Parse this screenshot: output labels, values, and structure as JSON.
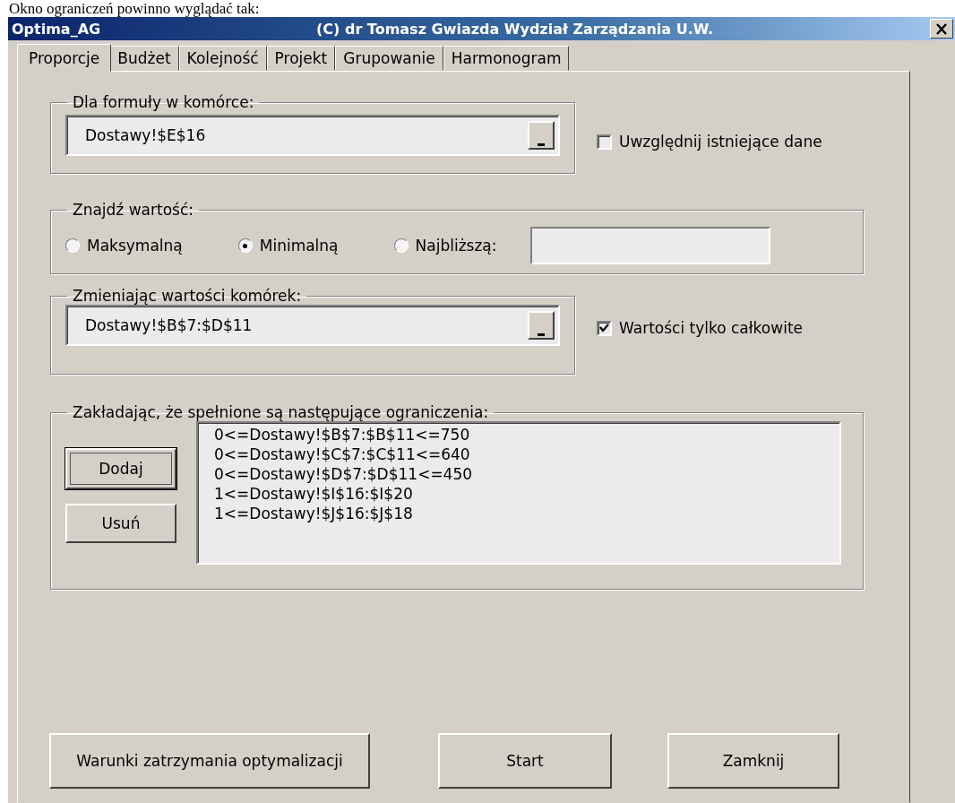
{
  "document_text": "Okno ograniczeń powinno wyglądać tak:",
  "window": {
    "title": "Optima_AG",
    "credit": "(C) dr Tomasz Gwiazda Wydział Zarządzania U.W."
  },
  "tabs": [
    {
      "label": "Proporcje",
      "selected": true
    },
    {
      "label": "Budżet",
      "selected": false
    },
    {
      "label": "Kolejność",
      "selected": false
    },
    {
      "label": "Projekt",
      "selected": false
    },
    {
      "label": "Grupowanie",
      "selected": false
    },
    {
      "label": "Harmonogram",
      "selected": false
    }
  ],
  "formula_cell": {
    "legend": "Dla formuły w komórce:",
    "value": "Dostawy!$E$16"
  },
  "include_existing": {
    "label": "Uwzględnij istniejące dane",
    "checked": false
  },
  "find_value": {
    "legend": "Znajdź wartość:",
    "options": [
      {
        "label": "Maksymalną",
        "selected": false
      },
      {
        "label": "Minimalną",
        "selected": true
      },
      {
        "label": "Najbliższą:",
        "selected": false
      }
    ]
  },
  "changing_cells": {
    "legend": "Zmieniając wartości komórek:",
    "value": "Dostawy!$B$7:$D$11"
  },
  "integers_only": {
    "label": "Wartości tylko całkowite",
    "checked": true
  },
  "constraints": {
    "legend": "Zakładając, że spełnione są następujące ograniczenia:",
    "add": "Dodaj",
    "remove": "Usuń",
    "items": [
      "0<=Dostawy!$B$7:$B$11<=750",
      "0<=Dostawy!$C$7:$C$11<=640",
      "0<=Dostawy!$D$7:$D$11<=450",
      "1<=Dostawy!$I$16:$I$20",
      "1<=Dostawy!$J$16:$J$18"
    ]
  },
  "buttons": [
    "Warunki zatrzymania optymalizacji",
    "Start",
    "Zamknij"
  ]
}
